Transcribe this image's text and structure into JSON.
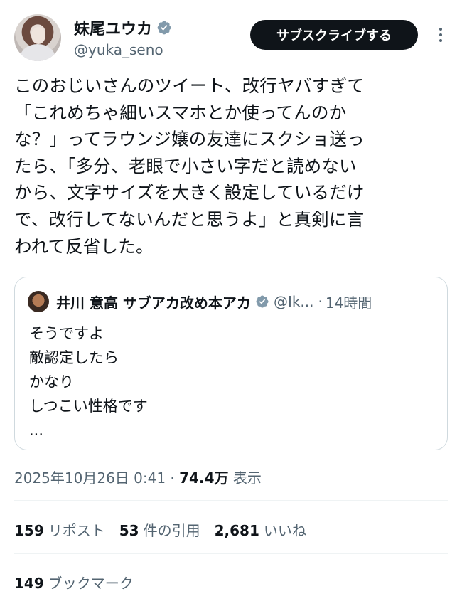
{
  "author": {
    "display_name": "妹尾ユウカ",
    "handle": "@yuka_seno",
    "verified_icon": "verified-badge-icon"
  },
  "header": {
    "subscribe_label": "サブスクライブする",
    "more_icon": "more-options-icon"
  },
  "tweet": {
    "lines": [
      "このおじいさんのツイート、改行ヤバすぎて",
      "「これめちゃ細いスマホとか使ってんのか",
      "な？」ってラウンジ嬢の友達にスクショ送っ",
      "たら、「多分、老眼で小さい字だと読めない",
      "から、文字サイズを大きく設定しているだけ",
      "で、改行してないんだと思うよ」と真剣に言",
      "われて反省した。"
    ]
  },
  "quote": {
    "display_name": "井川 意高 サブアカ改め本アカ",
    "handle": "@Ik...",
    "separator": "·",
    "time": "14時間",
    "lines": [
      "そうですよ",
      "敵認定したら",
      "かなり",
      "しつこい性格です",
      "..."
    ]
  },
  "meta": {
    "datetime": "2025年10月26日 0:41 · ",
    "views_count": "74.4万",
    "views_label": " 表示"
  },
  "stats": {
    "reposts_count": "159",
    "reposts_label": "リポスト",
    "quotes_count": "53",
    "quotes_label": "件の引用",
    "likes_count": "2,681",
    "likes_label": "いいね",
    "bookmarks_count": "149",
    "bookmarks_label": "ブックマーク"
  },
  "colors": {
    "text": "#0f1419",
    "secondary": "#536471",
    "verified": "#829aab",
    "border": "#cfd9de",
    "button_bg": "#0f1419"
  }
}
